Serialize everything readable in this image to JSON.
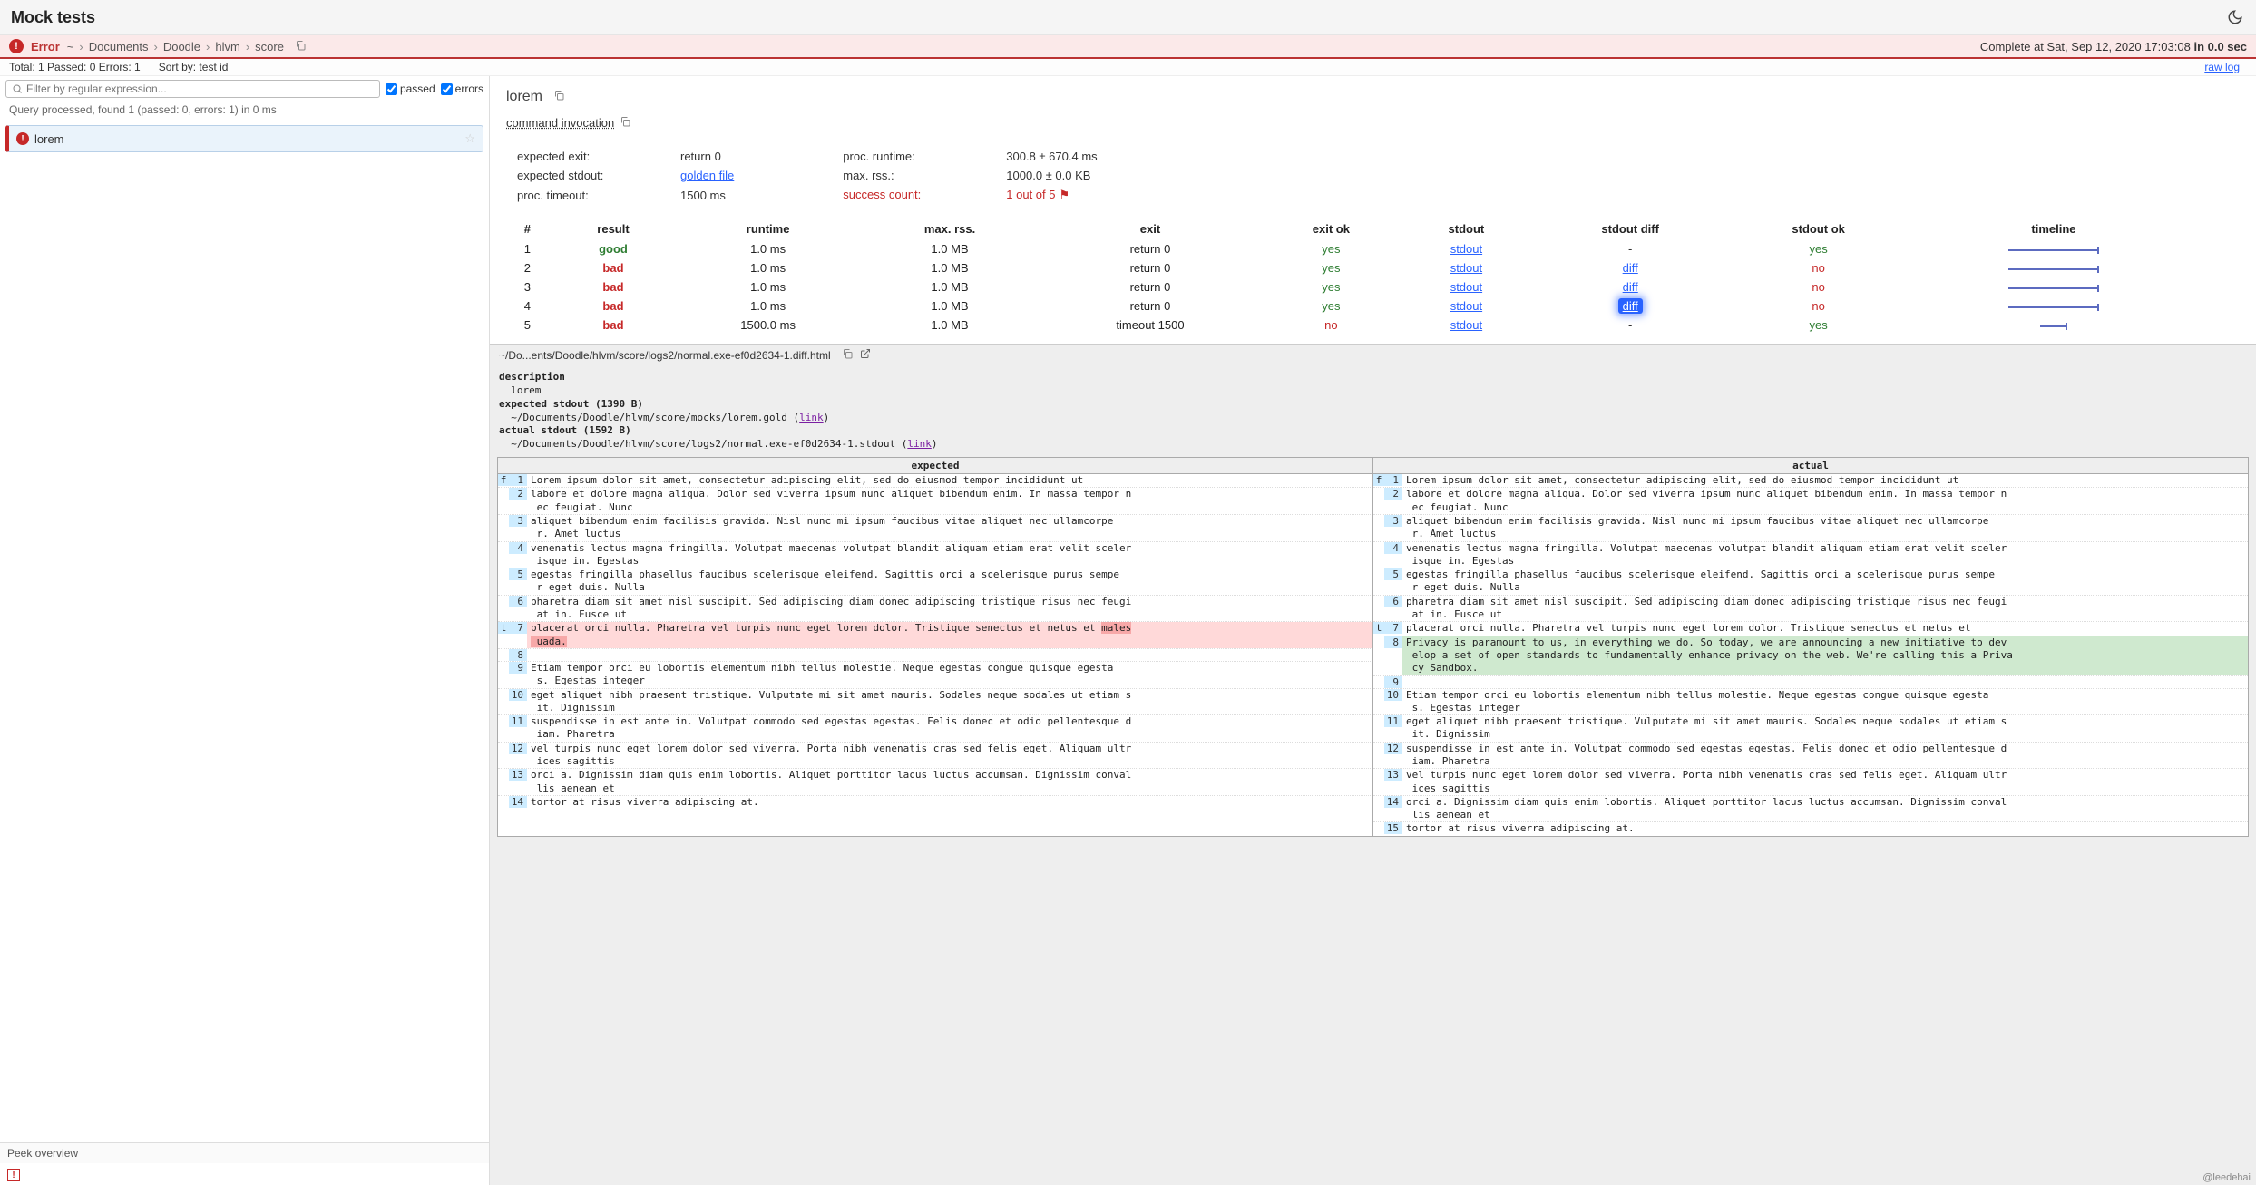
{
  "title": "Mock tests",
  "status": {
    "label": "Error",
    "breadcrumb": [
      "~",
      "Documents",
      "Doodle",
      "hlvm",
      "score"
    ],
    "complete": "Complete at Sat, Sep 12, 2020 17:03:08 ",
    "complete_bold": "in 0.0 sec"
  },
  "meta": {
    "counts": "Total: 1   Passed: 0   Errors: 1",
    "sort": "Sort by: test id",
    "raw_log": "raw log"
  },
  "filter": {
    "placeholder": "Filter by regular expression...",
    "passed_label": "passed",
    "errors_label": "errors",
    "query_msg": "Query processed, found 1 (passed: 0, errors: 1) in 0 ms"
  },
  "tests": [
    {
      "name": "lorem"
    }
  ],
  "peek": {
    "label": "Peek overview"
  },
  "detail": {
    "title": "lorem",
    "command": "command invocation",
    "info_left": [
      {
        "label": "expected exit:",
        "value": "return 0"
      },
      {
        "label": "expected stdout:",
        "value": "golden file",
        "link": true
      },
      {
        "label": "proc. timeout:",
        "value": "1500 ms"
      }
    ],
    "info_right": [
      {
        "label": "proc. runtime:",
        "value": "300.8 ± 670.4 ms"
      },
      {
        "label": "max. rss.:",
        "value": "1000.0 ± 0.0 KB"
      },
      {
        "label": "success count:",
        "value": "1 out of 5",
        "danger": true
      }
    ],
    "table_headers": [
      "#",
      "result",
      "runtime",
      "max. rss.",
      "exit",
      "exit ok",
      "stdout",
      "stdout diff",
      "stdout ok",
      "timeline"
    ],
    "runs": [
      {
        "n": "1",
        "result": "good",
        "runtime": "1.0 ms",
        "rss": "1.0 MB",
        "exit": "return 0",
        "exit_ok": "yes",
        "stdout": "stdout",
        "diff": "-",
        "stdout_ok": "yes",
        "tl": "long"
      },
      {
        "n": "2",
        "result": "bad",
        "runtime": "1.0 ms",
        "rss": "1.0 MB",
        "exit": "return 0",
        "exit_ok": "yes",
        "stdout": "stdout",
        "diff": "diff",
        "stdout_ok": "no",
        "tl": "long"
      },
      {
        "n": "3",
        "result": "bad",
        "runtime": "1.0 ms",
        "rss": "1.0 MB",
        "exit": "return 0",
        "exit_ok": "yes",
        "stdout": "stdout",
        "diff": "diff",
        "stdout_ok": "no",
        "tl": "long"
      },
      {
        "n": "4",
        "result": "bad",
        "runtime": "1.0 ms",
        "rss": "1.0 MB",
        "exit": "return 0",
        "exit_ok": "yes",
        "stdout": "stdout",
        "diff": "diff",
        "stdout_ok": "no",
        "tl": "long",
        "active": true
      },
      {
        "n": "5",
        "result": "bad",
        "runtime": "1500.0 ms",
        "rss": "1.0 MB",
        "exit": "timeout 1500",
        "exit_ok": "no",
        "stdout": "stdout",
        "diff": "-",
        "stdout_ok": "yes",
        "tl": "short"
      }
    ]
  },
  "diff": {
    "path": "~/Do...ents/Doodle/hlvm/score/logs2/normal.exe-ef0d2634-1.diff.html",
    "meta_lines": [
      "description",
      "  lorem",
      "expected stdout (1390 B)",
      "  ~/Documents/Doodle/hlvm/score/mocks/lorem.gold (link)",
      "actual stdout (1592 B)",
      "  ~/Documents/Doodle/hlvm/score/logs2/normal.exe-ef0d2634-1.stdout (link)"
    ],
    "head_left": "expected",
    "head_right": "actual",
    "left": [
      {
        "m": "f",
        "n": "1",
        "t": "Lorem ipsum dolor sit amet, consectetur adipiscing elit, sed do eiusmod tempor incididunt ut"
      },
      {
        "m": "",
        "n": "2",
        "t": "labore et dolore magna aliqua. Dolor sed viverra ipsum nunc aliquet bibendum enim. In massa tempor n\n ec feugiat. Nunc"
      },
      {
        "m": "",
        "n": "3",
        "t": "aliquet bibendum enim facilisis gravida. Nisl nunc mi ipsum faucibus vitae aliquet nec ullamcorpe\n r. Amet luctus"
      },
      {
        "m": "",
        "n": "4",
        "t": "venenatis lectus magna fringilla. Volutpat maecenas volutpat blandit aliquam etiam erat velit sceler\n isque in. Egestas"
      },
      {
        "m": "",
        "n": "5",
        "t": "egestas fringilla phasellus faucibus scelerisque eleifend. Sagittis orci a scelerisque purus sempe\n r eget duis. Nulla"
      },
      {
        "m": "",
        "n": "6",
        "t": "pharetra diam sit amet nisl suscipit. Sed adipiscing diam donec adipiscing tristique risus nec feugi\n at in. Fusce ut"
      },
      {
        "m": "t",
        "n": "7",
        "t": "placerat orci nulla. Pharetra vel turpis nunc eget lorem dolor. Tristique senectus et netus et males\n uada.",
        "cls": "dremove"
      },
      {
        "m": "",
        "n": "8",
        "t": ""
      },
      {
        "m": "",
        "n": "9",
        "t": "Etiam tempor orci eu lobortis elementum nibh tellus molestie. Neque egestas congue quisque egesta\n s. Egestas integer"
      },
      {
        "m": "",
        "n": "10",
        "t": "eget aliquet nibh praesent tristique. Vulputate mi sit amet mauris. Sodales neque sodales ut etiam s\n it. Dignissim"
      },
      {
        "m": "",
        "n": "11",
        "t": "suspendisse in est ante in. Volutpat commodo sed egestas egestas. Felis donec et odio pellentesque d\n iam. Pharetra"
      },
      {
        "m": "",
        "n": "12",
        "t": "vel turpis nunc eget lorem dolor sed viverra. Porta nibh venenatis cras sed felis eget. Aliquam ultr\n ices sagittis"
      },
      {
        "m": "",
        "n": "13",
        "t": "orci a. Dignissim diam quis enim lobortis. Aliquet porttitor lacus luctus accumsan. Dignissim conval\n lis aenean et"
      },
      {
        "m": "",
        "n": "14",
        "t": "tortor at risus viverra adipiscing at."
      }
    ],
    "right": [
      {
        "m": "f",
        "n": "1",
        "t": "Lorem ipsum dolor sit amet, consectetur adipiscing elit, sed do eiusmod tempor incididunt ut"
      },
      {
        "m": "",
        "n": "2",
        "t": "labore et dolore magna aliqua. Dolor sed viverra ipsum nunc aliquet bibendum enim. In massa tempor n\n ec feugiat. Nunc"
      },
      {
        "m": "",
        "n": "3",
        "t": "aliquet bibendum enim facilisis gravida. Nisl nunc mi ipsum faucibus vitae aliquet nec ullamcorpe\n r. Amet luctus"
      },
      {
        "m": "",
        "n": "4",
        "t": "venenatis lectus magna fringilla. Volutpat maecenas volutpat blandit aliquam etiam erat velit sceler\n isque in. Egestas"
      },
      {
        "m": "",
        "n": "5",
        "t": "egestas fringilla phasellus faucibus scelerisque eleifend. Sagittis orci a scelerisque purus sempe\n r eget duis. Nulla"
      },
      {
        "m": "",
        "n": "6",
        "t": "pharetra diam sit amet nisl suscipit. Sed adipiscing diam donec adipiscing tristique risus nec feugi\n at in. Fusce ut"
      },
      {
        "m": "t",
        "n": "7",
        "t": "placerat orci nulla. Pharetra vel turpis nunc eget lorem dolor. Tristique senectus et netus et"
      },
      {
        "m": "",
        "n": "8",
        "t": "Privacy is paramount to us, in everything we do. So today, we are announcing a new initiative to dev\n elop a set of open standards to fundamentally enhance privacy on the web. We're calling this a Priva\n cy Sandbox.",
        "cls": "dadd"
      },
      {
        "m": "",
        "n": "9",
        "t": ""
      },
      {
        "m": "",
        "n": "10",
        "t": "Etiam tempor orci eu lobortis elementum nibh tellus molestie. Neque egestas congue quisque egesta\n s. Egestas integer"
      },
      {
        "m": "",
        "n": "11",
        "t": "eget aliquet nibh praesent tristique. Vulputate mi sit amet mauris. Sodales neque sodales ut etiam s\n it. Dignissim"
      },
      {
        "m": "",
        "n": "12",
        "t": "suspendisse in est ante in. Volutpat commodo sed egestas egestas. Felis donec et odio pellentesque d\n iam. Pharetra"
      },
      {
        "m": "",
        "n": "13",
        "t": "vel turpis nunc eget lorem dolor sed viverra. Porta nibh venenatis cras sed felis eget. Aliquam ultr\n ices sagittis"
      },
      {
        "m": "",
        "n": "14",
        "t": "orci a. Dignissim diam quis enim lobortis. Aliquet porttitor lacus luctus accumsan. Dignissim conval\n lis aenean et"
      },
      {
        "m": "",
        "n": "15",
        "t": "tortor at risus viverra adipiscing at."
      }
    ]
  },
  "footer": "@leedehai"
}
